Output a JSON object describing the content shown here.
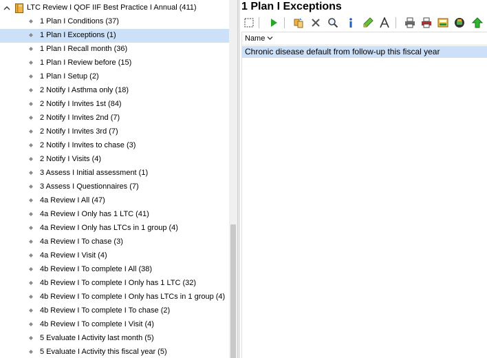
{
  "tree": {
    "root_label": "LTC Review I QOF IIF Best Practice I Annual (411)",
    "selected_index": 1,
    "items": [
      {
        "label": "1 Plan I Conditions (37)"
      },
      {
        "label": "1 Plan I Exceptions (1)"
      },
      {
        "label": "1 Plan I Recall month (36)"
      },
      {
        "label": "1 Plan I Review before (15)"
      },
      {
        "label": "1 Plan I Setup (2)"
      },
      {
        "label": "2 Notify I Asthma only (18)"
      },
      {
        "label": "2 Notify I Invites 1st (84)"
      },
      {
        "label": "2 Notify I Invites 2nd (7)"
      },
      {
        "label": "2 Notify I Invites 3rd (7)"
      },
      {
        "label": "2 Notify I Invites to chase (3)"
      },
      {
        "label": "2 Notify I Visits (4)"
      },
      {
        "label": "3 Assess I Initial assessment (1)"
      },
      {
        "label": "3 Assess I Questionnaires (7)"
      },
      {
        "label": "4a Review I All (47)"
      },
      {
        "label": "4a Review I Only has 1 LTC (41)"
      },
      {
        "label": "4a Review I Only has LTCs in 1 group (4)"
      },
      {
        "label": "4a Review I To chase (3)"
      },
      {
        "label": "4a Review I Visit (4)"
      },
      {
        "label": "4b Review I To complete I All (38)"
      },
      {
        "label": "4b Review I To complete I Only has 1 LTC (32)"
      },
      {
        "label": "4b Review I To complete I Only has LTCs in 1 group (4)"
      },
      {
        "label": "4b Review I To complete I To chase (2)"
      },
      {
        "label": "4b Review I To complete I Visit (4)"
      },
      {
        "label": "5 Evaluate I Activity last month (5)"
      },
      {
        "label": "5 Evaluate I Activity this fiscal year (5)"
      }
    ]
  },
  "panel": {
    "title": "1 Plan I Exceptions",
    "column_header": "Name",
    "rows": [
      {
        "name": "Chronic disease default from follow-up this fiscal year"
      }
    ]
  },
  "toolbar": {
    "icons": [
      "select-all-icon",
      "run-icon",
      "copy-icon",
      "delete-icon",
      "search-icon",
      "info-icon",
      "edit-icon",
      "font-icon",
      "print-icon",
      "print-color-icon",
      "export-icon",
      "database-icon",
      "upload-icon"
    ]
  },
  "colors": {
    "selection": "#cce0f7",
    "run_green": "#2aa52a",
    "delete_gray": "#555555",
    "info_blue": "#1f5fbf"
  }
}
